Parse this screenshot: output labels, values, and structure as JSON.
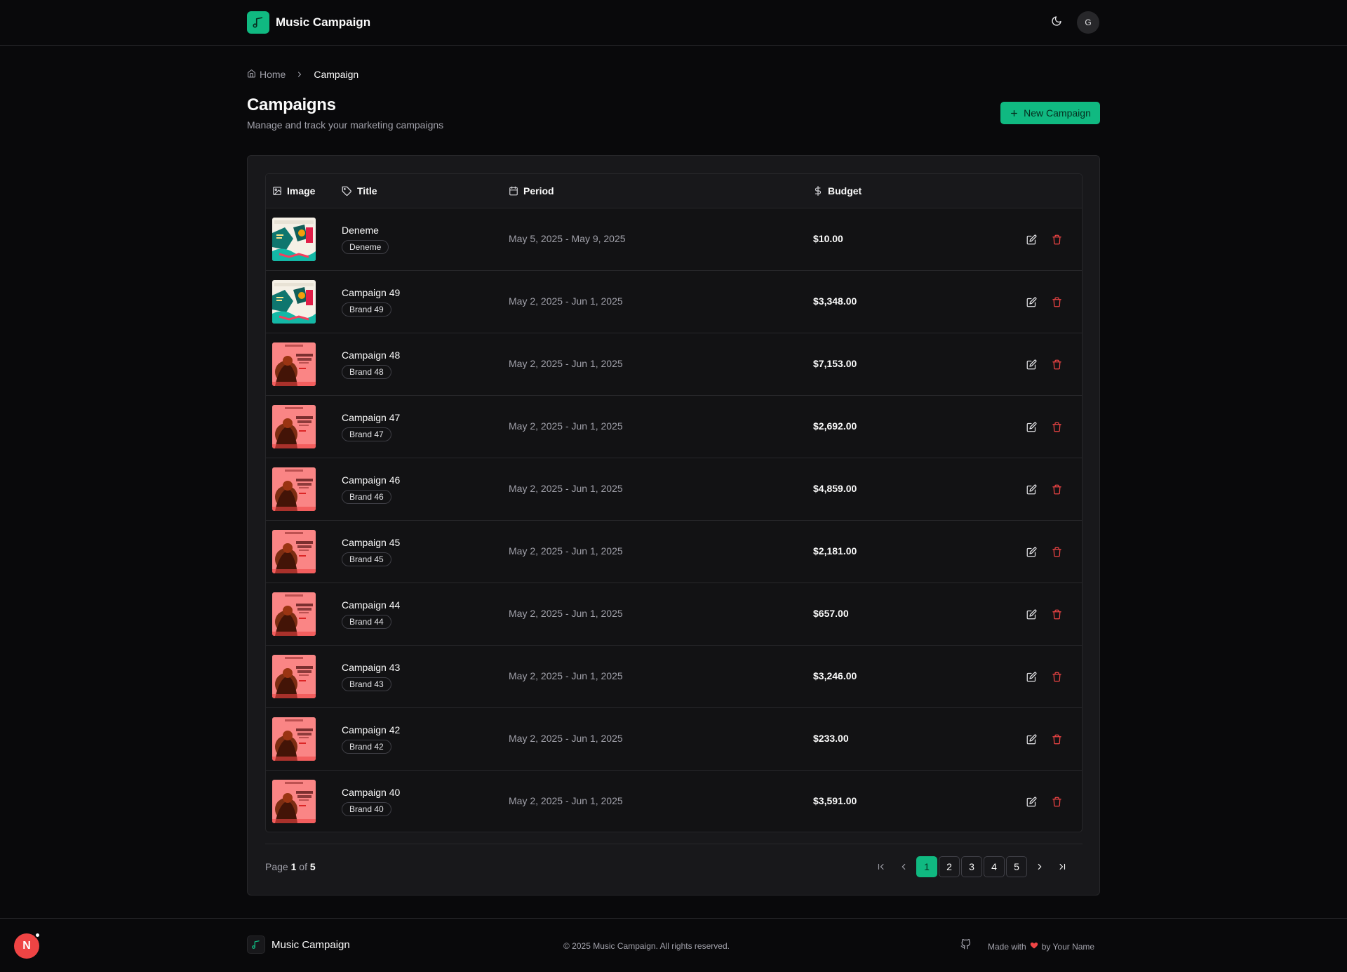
{
  "header": {
    "brand": "Music Campaign",
    "avatar_initial": "G"
  },
  "breadcrumb": {
    "home": "Home",
    "current": "Campaign"
  },
  "page": {
    "title": "Campaigns",
    "subtitle": "Manage and track your marketing campaigns",
    "new_button": "New Campaign"
  },
  "table": {
    "columns": {
      "image": "Image",
      "title": "Title",
      "period": "Period",
      "budget": "Budget"
    },
    "rows": [
      {
        "title": "Deneme",
        "brand": "Deneme",
        "period": "May 5, 2025 - May 9, 2025",
        "budget": "$10.00",
        "thumb": "teal-poster"
      },
      {
        "title": "Campaign 49",
        "brand": "Brand 49",
        "period": "May 2, 2025 - Jun 1, 2025",
        "budget": "$3,348.00",
        "thumb": "teal-poster"
      },
      {
        "title": "Campaign 48",
        "brand": "Brand 48",
        "period": "May 2, 2025 - Jun 1, 2025",
        "budget": "$7,153.00",
        "thumb": "red-poster"
      },
      {
        "title": "Campaign 47",
        "brand": "Brand 47",
        "period": "May 2, 2025 - Jun 1, 2025",
        "budget": "$2,692.00",
        "thumb": "red-poster"
      },
      {
        "title": "Campaign 46",
        "brand": "Brand 46",
        "period": "May 2, 2025 - Jun 1, 2025",
        "budget": "$4,859.00",
        "thumb": "red-poster"
      },
      {
        "title": "Campaign 45",
        "brand": "Brand 45",
        "period": "May 2, 2025 - Jun 1, 2025",
        "budget": "$2,181.00",
        "thumb": "red-poster"
      },
      {
        "title": "Campaign 44",
        "brand": "Brand 44",
        "period": "May 2, 2025 - Jun 1, 2025",
        "budget": "$657.00",
        "thumb": "red-poster"
      },
      {
        "title": "Campaign 43",
        "brand": "Brand 43",
        "period": "May 2, 2025 - Jun 1, 2025",
        "budget": "$3,246.00",
        "thumb": "red-poster"
      },
      {
        "title": "Campaign 42",
        "brand": "Brand 42",
        "period": "May 2, 2025 - Jun 1, 2025",
        "budget": "$233.00",
        "thumb": "red-poster"
      },
      {
        "title": "Campaign 40",
        "brand": "Brand 40",
        "period": "May 2, 2025 - Jun 1, 2025",
        "budget": "$3,591.00",
        "thumb": "red-poster"
      }
    ]
  },
  "pagination": {
    "page_word": "Page",
    "of_word": "of",
    "current": "1",
    "total": "5",
    "pages": [
      "1",
      "2",
      "3",
      "4",
      "5"
    ]
  },
  "footer": {
    "brand": "Music Campaign",
    "copyright": "© 2025 Music Campaign. All rights reserved.",
    "made_with": "Made with",
    "by": "by Your Name"
  },
  "dev_badge": "N",
  "colors": {
    "accent": "#10b981",
    "danger": "#ef4444",
    "background": "#09090b",
    "card": "#18181b",
    "border": "#27272a"
  },
  "icons": {
    "logo": "music-note-icon",
    "theme": "moon-icon",
    "home": "home-icon",
    "chevron": "chevron-right-icon",
    "plus": "plus-icon",
    "image": "image-icon",
    "tag": "tag-icon",
    "calendar": "calendar-icon",
    "dollar": "dollar-icon",
    "edit": "edit-icon",
    "delete": "trash-icon",
    "github": "github-icon",
    "heart": "heart-icon"
  }
}
